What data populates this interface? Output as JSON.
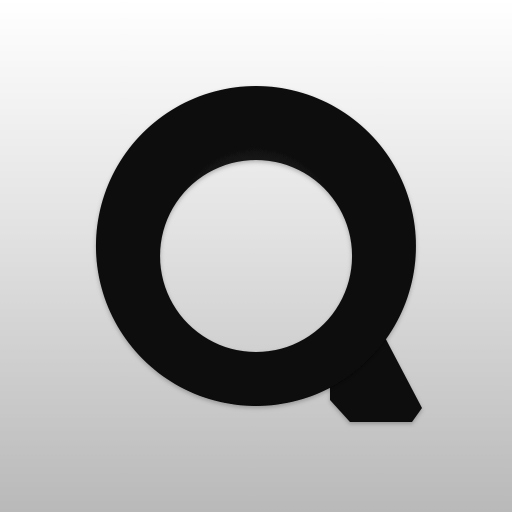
{
  "app_icon": {
    "logo": "magnifier-q-logo-icon",
    "colors": {
      "background_top": "#ffffff",
      "background_bottom": "#b9b9b9",
      "glyph": "#0b0b0b"
    }
  }
}
